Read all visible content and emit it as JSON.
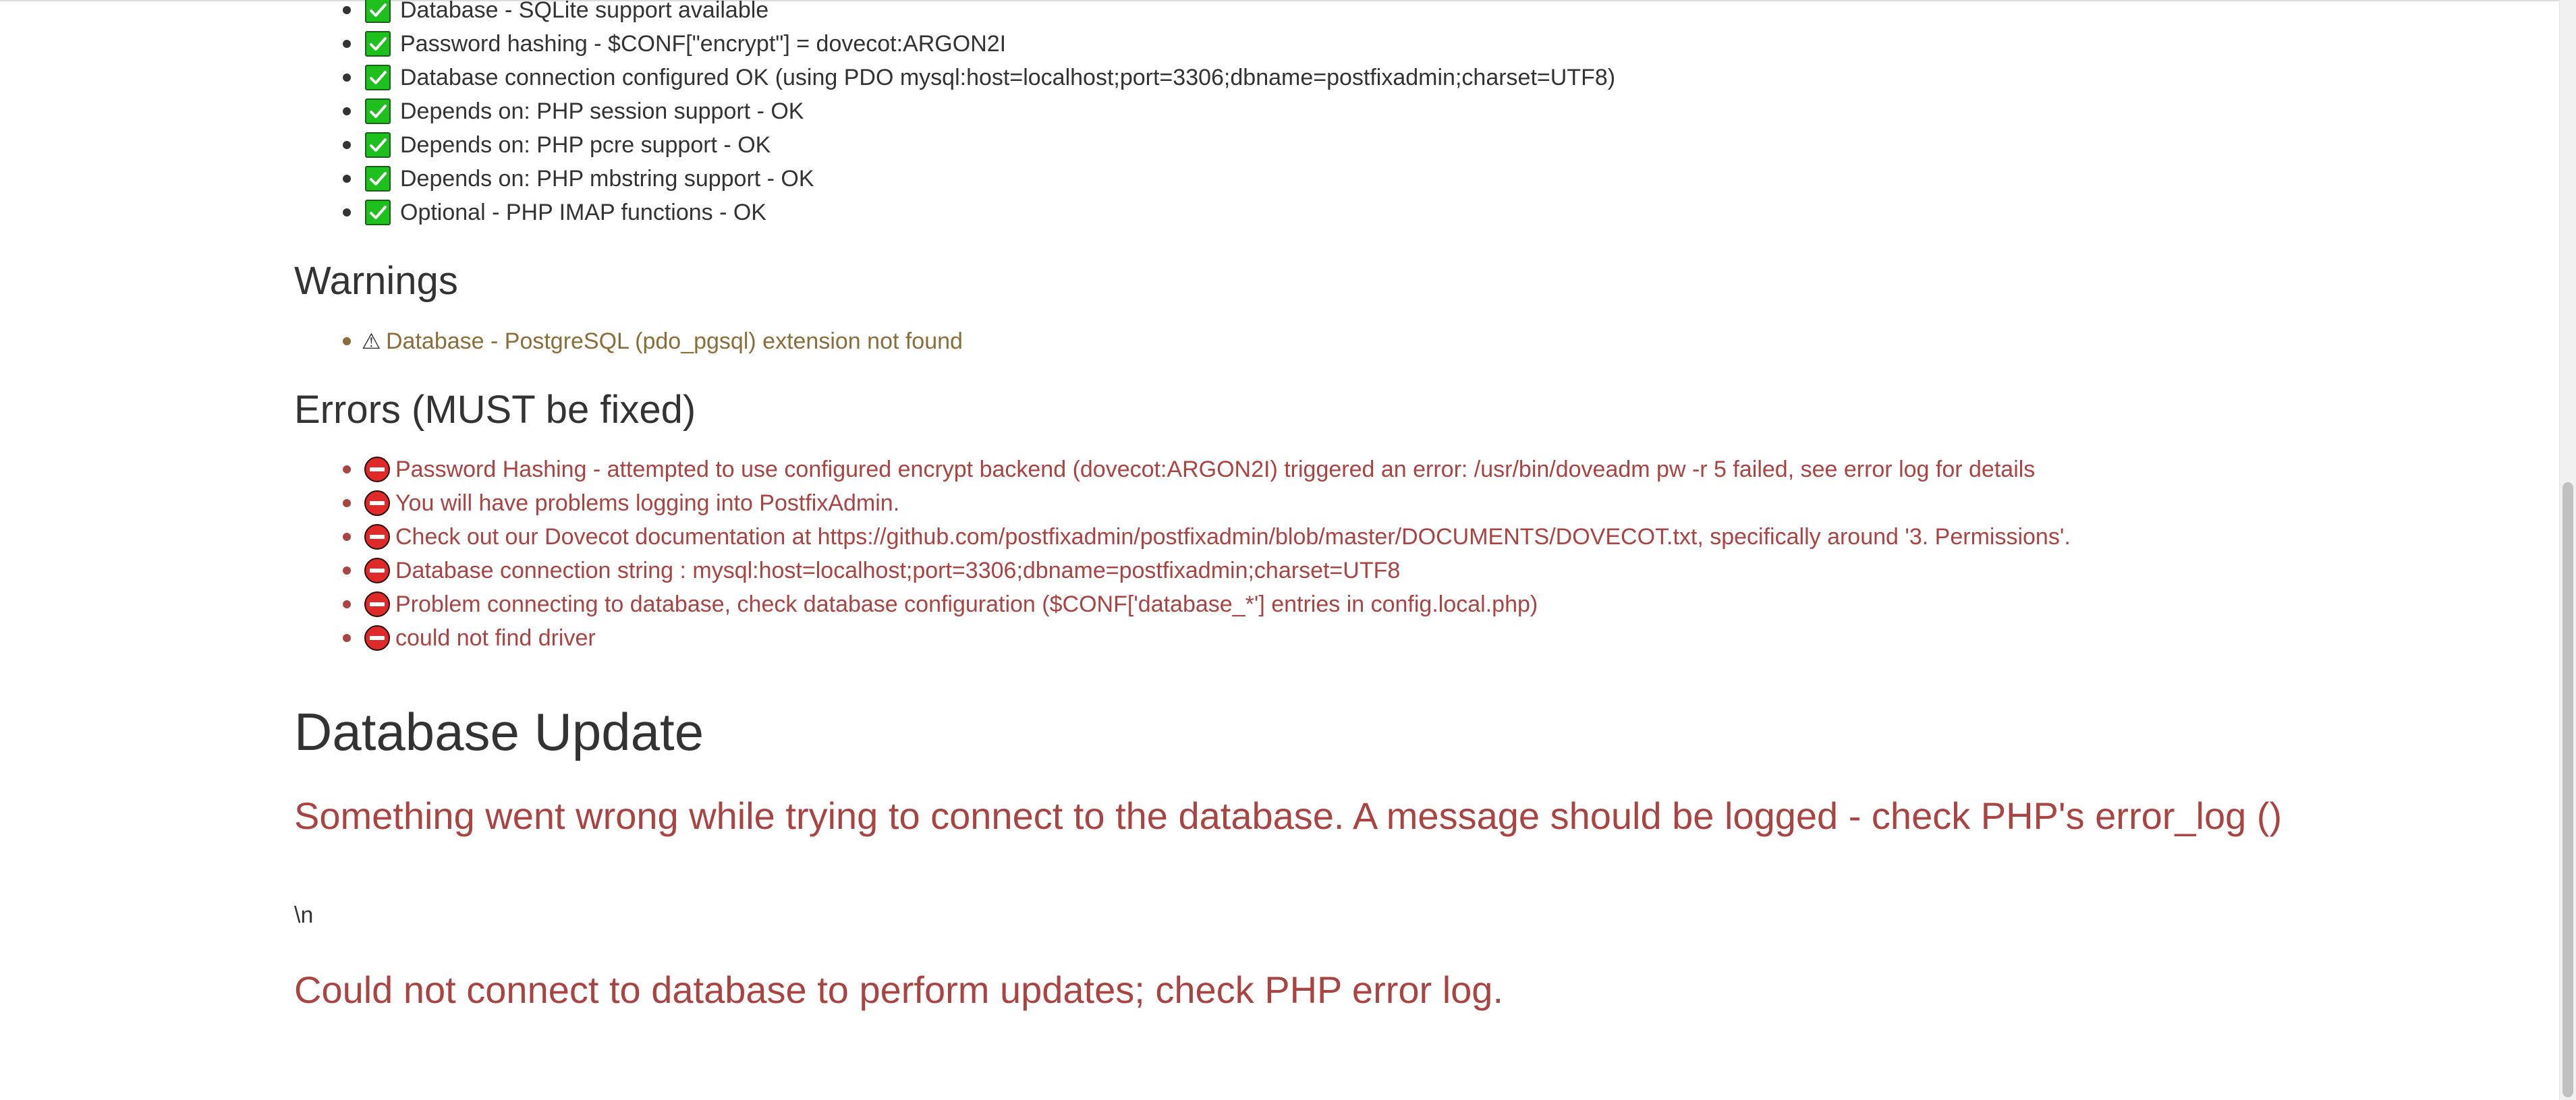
{
  "checks": [
    "Database - SQLite support available",
    "Password hashing - $CONF[\"encrypt\"] = dovecot:ARGON2I",
    "Database connection configured OK (using PDO mysql:host=localhost;port=3306;dbname=postfixadmin;charset=UTF8)",
    "Depends on: PHP session support - OK",
    "Depends on: PHP pcre support - OK",
    "Depends on: PHP mbstring support - OK",
    "Optional - PHP IMAP functions - OK"
  ],
  "warnings": {
    "heading": "Warnings",
    "items": [
      "Database - PostgreSQL (pdo_pgsql) extension not found"
    ]
  },
  "errors": {
    "heading": "Errors (MUST be fixed)",
    "items": [
      "Password Hashing - attempted to use configured encrypt backend (dovecot:ARGON2I) triggered an error: /usr/bin/doveadm pw -r 5 failed, see error log for details",
      "You will have problems logging into PostfixAdmin.",
      "Check out our Dovecot documentation at https://github.com/postfixadmin/postfixadmin/blob/master/DOCUMENTS/DOVECOT.txt, specifically around '3. Permissions'.",
      "Database connection string : mysql:host=localhost;port=3306;dbname=postfixadmin;charset=UTF8",
      "Problem connecting to database, check database configuration ($CONF['database_*'] entries in config.local.php)",
      "could not find driver"
    ]
  },
  "db_update": {
    "title": "Database Update",
    "error_message": "Something went wrong while trying to connect to the database. A message should be logged - check PHP's error_log ()",
    "newline_text": "\\n",
    "connect_error": "Could not connect to database to perform updates; check PHP error log."
  },
  "icons": {
    "check": "check-box-icon",
    "warning": "warning-sign-icon",
    "error": "no-entry-icon"
  },
  "colors": {
    "text": "#333333",
    "warning": "#8a6d3b",
    "error": "#a94442",
    "check_green": "#1ec01e",
    "error_red": "#e02a2a"
  }
}
